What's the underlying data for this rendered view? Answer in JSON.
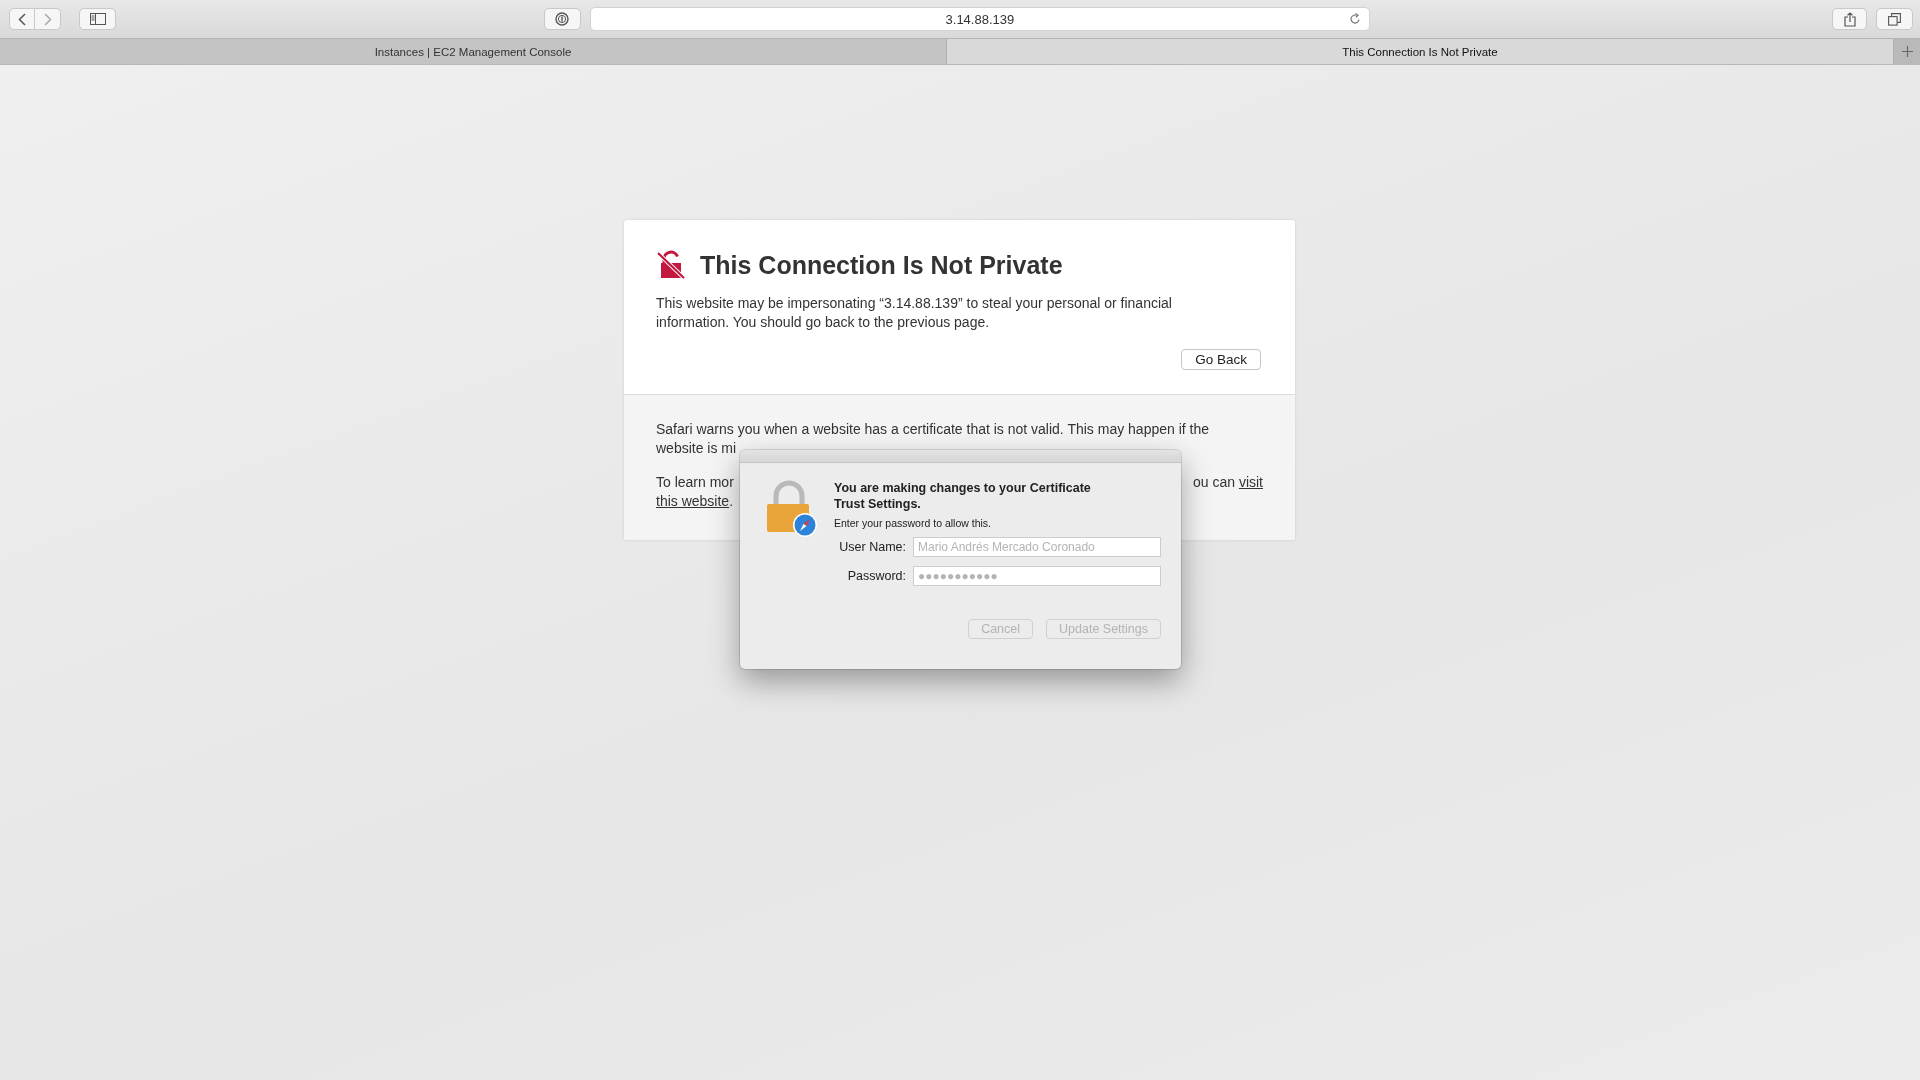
{
  "toolbar": {
    "address": "3.14.88.139"
  },
  "tabs": [
    {
      "title": "Instances | EC2 Management Console",
      "selected": false
    },
    {
      "title": "This Connection Is Not Private",
      "selected": true
    }
  ],
  "warning": {
    "title": "This Connection Is Not Private",
    "message": "This website may be impersonating “3.14.88.139” to steal your personal or financial information. You should go back to the previous page.",
    "go_back_button": "Go Back",
    "details": [
      {
        "lines": [
          {
            "left": [
              {
                "kind": "text",
                "text": "Safari warns you when a website has a certificate that is not valid. This may happen if the"
              }
            ]
          },
          {
            "left": [
              {
                "kind": "text",
                "text": "website is mi"
              }
            ]
          }
        ]
      },
      {
        "lines": [
          {
            "left": [
              {
                "kind": "text",
                "text": "To learn mor"
              }
            ],
            "right": [
              {
                "kind": "text",
                "text": "ou can"
              },
              {
                "kind": "link",
                "text": "visit"
              }
            ]
          },
          {
            "left": [
              {
                "kind": "link",
                "text": "this website"
              },
              {
                "kind": "text",
                "text": "."
              }
            ]
          }
        ]
      }
    ]
  },
  "dialog": {
    "heading": "You are making changes to your Certificate Trust Settings.",
    "prompt": "Enter your password to allow this.",
    "fields": [
      {
        "label": "User Name:",
        "value": "Mario Andrés Mercado Coronado",
        "disabled": true
      },
      {
        "label": "Password:",
        "value": "●●●●●●●●●●●",
        "disabled": true
      }
    ],
    "buttons": [
      {
        "label": "Cancel",
        "disabled": true
      },
      {
        "label": "Update Settings",
        "disabled": true
      }
    ]
  }
}
